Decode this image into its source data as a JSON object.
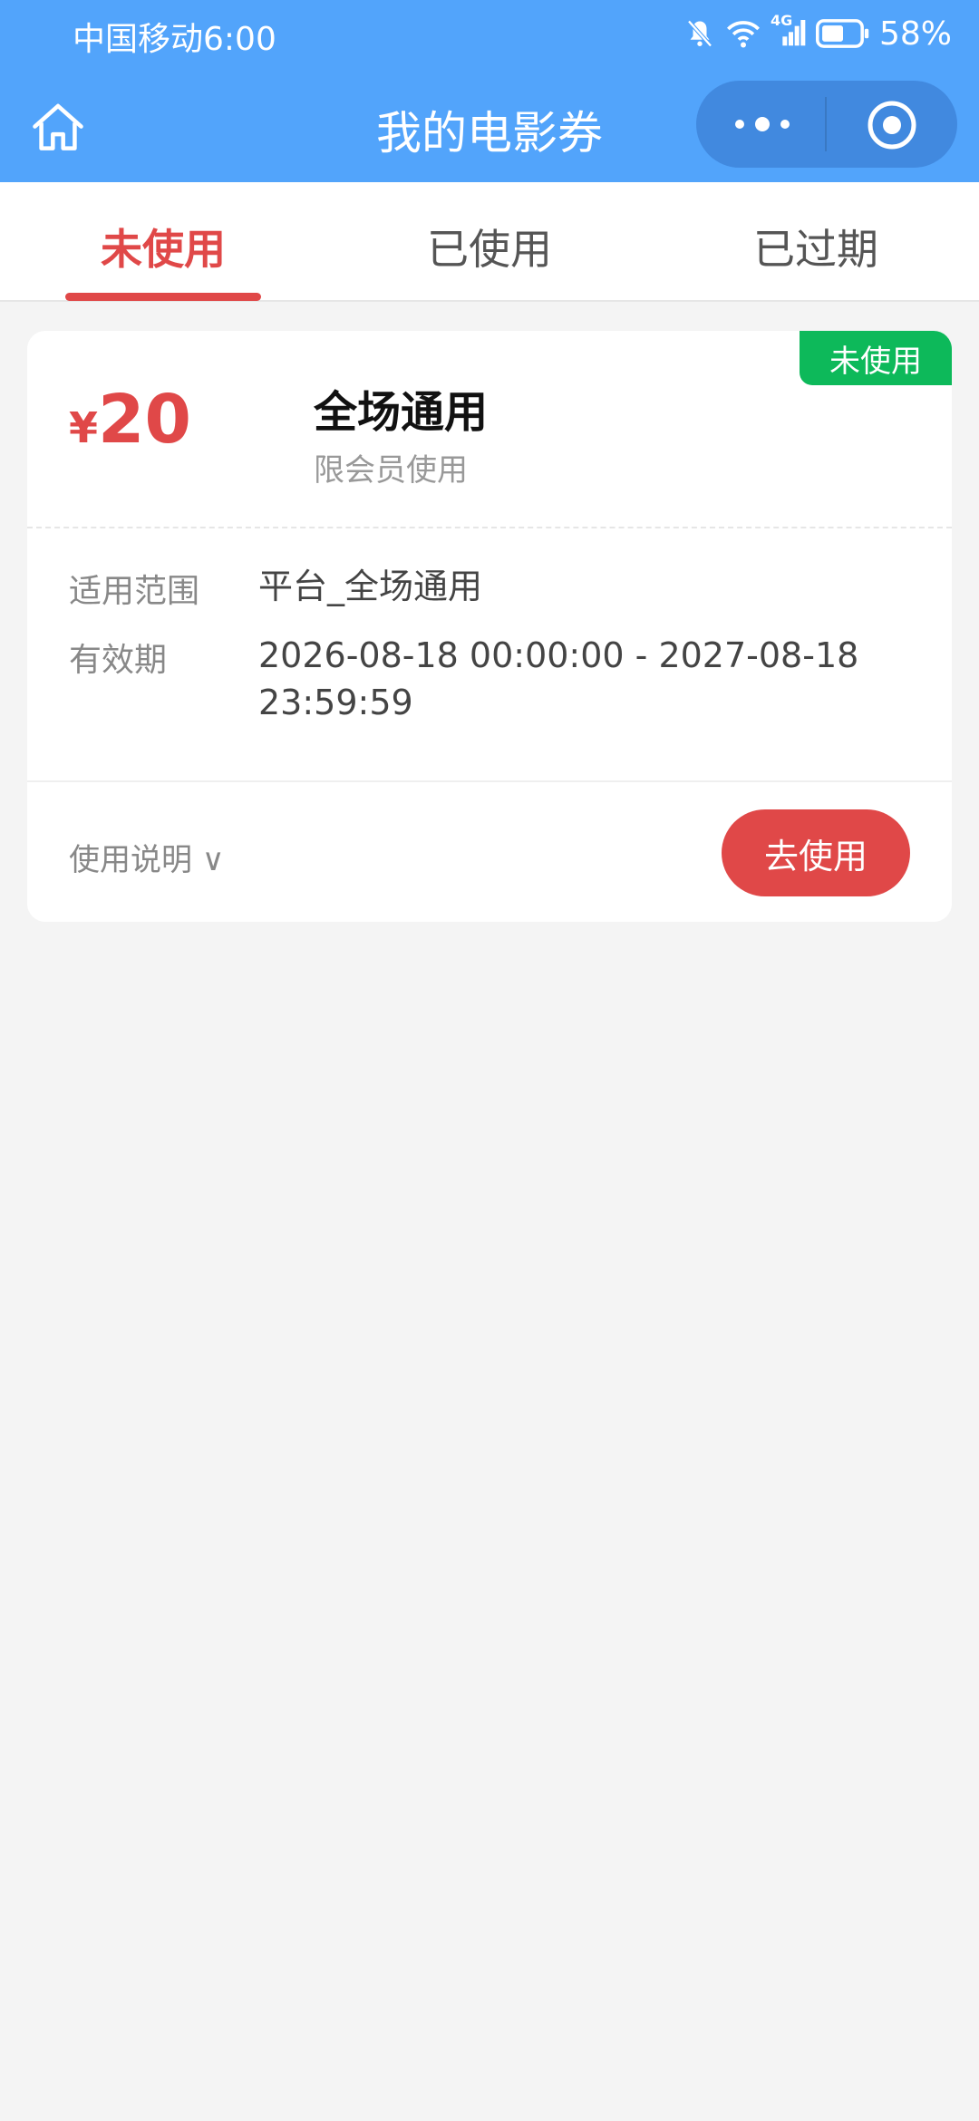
{
  "status_bar": {
    "carrier": "中国移动",
    "time": "6:00",
    "network": "4G",
    "battery": "58%"
  },
  "navbar": {
    "title": "我的电影券"
  },
  "tabs": [
    {
      "label": "未使用",
      "active": true
    },
    {
      "label": "已使用",
      "active": false
    },
    {
      "label": "已过期",
      "active": false
    }
  ],
  "coupon": {
    "status_badge": "未使用",
    "currency_symbol": "¥",
    "amount": "20",
    "title": "全场通用",
    "subtitle": "限会员使用",
    "scope_label": "适用范围",
    "scope_value": "平台_全场通用",
    "validity_label": "有效期",
    "validity_value": "2026-08-18 00:00:00 - 2027-08-18 23:59:59",
    "instructions_label": "使用说明 ∨",
    "use_button": "去使用"
  },
  "colors": {
    "header_bg": "#52a4fb",
    "accent_red": "#e04848",
    "badge_green": "#0db95a"
  }
}
